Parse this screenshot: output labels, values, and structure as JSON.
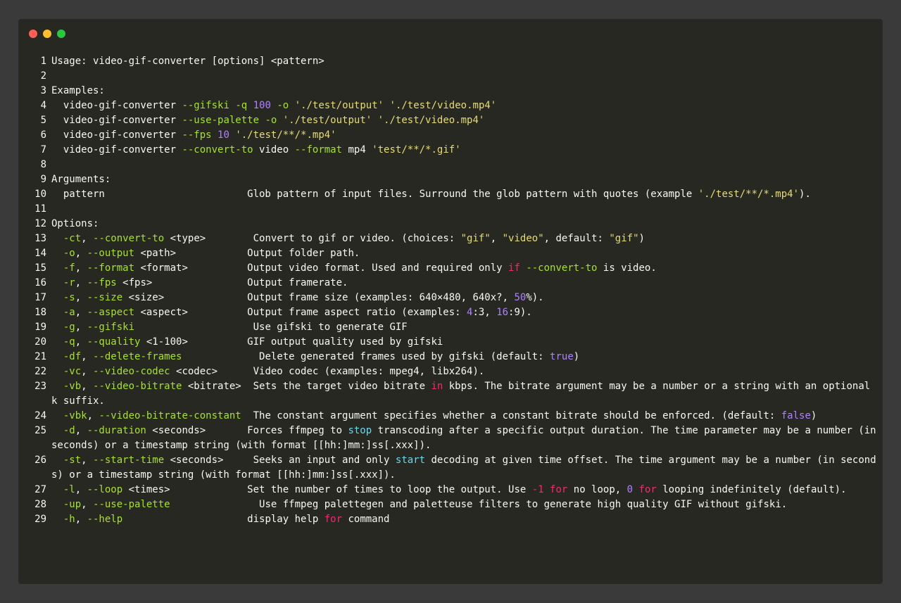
{
  "window": {
    "controls": [
      {
        "name": "close-button",
        "color": "#ff5f56"
      },
      {
        "name": "minimize-button",
        "color": "#ffbd2e"
      },
      {
        "name": "maximize-button",
        "color": "#27c93f"
      }
    ]
  },
  "colors": {
    "flag": "#a6e22e",
    "string": "#e6db74",
    "number": "#ae81ff",
    "keyword": "#f92672",
    "function": "#66d9ef",
    "text": "#f8f8f2",
    "background": "#272822"
  },
  "lines": [
    {
      "n": "1",
      "tokens": [
        {
          "t": "Usage: video-gif-converter [options] <pattern>"
        }
      ]
    },
    {
      "n": "2",
      "tokens": []
    },
    {
      "n": "3",
      "tokens": [
        {
          "t": "Examples:"
        }
      ]
    },
    {
      "n": "4",
      "tokens": [
        {
          "t": "  video-gif-converter "
        },
        {
          "t": "--gifski",
          "c": "flag"
        },
        {
          "t": " "
        },
        {
          "t": "-q",
          "c": "flag"
        },
        {
          "t": " "
        },
        {
          "t": "100",
          "c": "num"
        },
        {
          "t": " "
        },
        {
          "t": "-o",
          "c": "flag"
        },
        {
          "t": " "
        },
        {
          "t": "'./test/output'",
          "c": "str"
        },
        {
          "t": " "
        },
        {
          "t": "'./test/video.mp4'",
          "c": "str"
        }
      ]
    },
    {
      "n": "5",
      "tokens": [
        {
          "t": "  video-gif-converter "
        },
        {
          "t": "--use-palette",
          "c": "flag"
        },
        {
          "t": " "
        },
        {
          "t": "-o",
          "c": "flag"
        },
        {
          "t": " "
        },
        {
          "t": "'./test/output'",
          "c": "str"
        },
        {
          "t": " "
        },
        {
          "t": "'./test/video.mp4'",
          "c": "str"
        }
      ]
    },
    {
      "n": "6",
      "tokens": [
        {
          "t": "  video-gif-converter "
        },
        {
          "t": "--fps",
          "c": "flag"
        },
        {
          "t": " "
        },
        {
          "t": "10",
          "c": "num"
        },
        {
          "t": " "
        },
        {
          "t": "'./test/**/*.mp4'",
          "c": "str"
        }
      ]
    },
    {
      "n": "7",
      "tokens": [
        {
          "t": "  video-gif-converter "
        },
        {
          "t": "--convert-to",
          "c": "flag"
        },
        {
          "t": " video "
        },
        {
          "t": "--format",
          "c": "flag"
        },
        {
          "t": " mp4 "
        },
        {
          "t": "'test/**/*.gif'",
          "c": "str"
        }
      ]
    },
    {
      "n": "8",
      "tokens": []
    },
    {
      "n": "9",
      "tokens": [
        {
          "t": "Arguments:"
        }
      ]
    },
    {
      "n": "10",
      "tokens": [
        {
          "t": "  pattern                        Glob pattern of input files. Surround the glob pattern with quotes (example "
        },
        {
          "t": "'./test/**/*.mp4'",
          "c": "str"
        },
        {
          "t": ")."
        }
      ]
    },
    {
      "n": "11",
      "tokens": []
    },
    {
      "n": "12",
      "tokens": [
        {
          "t": "Options:"
        }
      ]
    },
    {
      "n": "13",
      "tokens": [
        {
          "t": "  "
        },
        {
          "t": "-ct",
          "c": "flag"
        },
        {
          "t": ", "
        },
        {
          "t": "--convert-to",
          "c": "flag"
        },
        {
          "t": " <type>        Convert to gif or video. (choices: "
        },
        {
          "t": "\"gif\"",
          "c": "str"
        },
        {
          "t": ", "
        },
        {
          "t": "\"video\"",
          "c": "str"
        },
        {
          "t": ", default: "
        },
        {
          "t": "\"gif\"",
          "c": "str"
        },
        {
          "t": ")"
        }
      ]
    },
    {
      "n": "14",
      "tokens": [
        {
          "t": "  "
        },
        {
          "t": "-o",
          "c": "flag"
        },
        {
          "t": ", "
        },
        {
          "t": "--output",
          "c": "flag"
        },
        {
          "t": " <path>            Output folder path."
        }
      ]
    },
    {
      "n": "15",
      "tokens": [
        {
          "t": "  "
        },
        {
          "t": "-f",
          "c": "flag"
        },
        {
          "t": ", "
        },
        {
          "t": "--format",
          "c": "flag"
        },
        {
          "t": " <format>          Output video format. Used and required only "
        },
        {
          "t": "if",
          "c": "kw"
        },
        {
          "t": " "
        },
        {
          "t": "--convert-to",
          "c": "flag"
        },
        {
          "t": " is video."
        }
      ]
    },
    {
      "n": "16",
      "tokens": [
        {
          "t": "  "
        },
        {
          "t": "-r",
          "c": "flag"
        },
        {
          "t": ", "
        },
        {
          "t": "--fps",
          "c": "flag"
        },
        {
          "t": " <fps>                Output framerate."
        }
      ]
    },
    {
      "n": "17",
      "tokens": [
        {
          "t": "  "
        },
        {
          "t": "-s",
          "c": "flag"
        },
        {
          "t": ", "
        },
        {
          "t": "--size",
          "c": "flag"
        },
        {
          "t": " <size>              Output frame size (examples: 640×480, 640x?, "
        },
        {
          "t": "50",
          "c": "num"
        },
        {
          "t": "%)."
        }
      ]
    },
    {
      "n": "18",
      "tokens": [
        {
          "t": "  "
        },
        {
          "t": "-a",
          "c": "flag"
        },
        {
          "t": ", "
        },
        {
          "t": "--aspect",
          "c": "flag"
        },
        {
          "t": " <aspect>          Output frame aspect ratio (examples: "
        },
        {
          "t": "4",
          "c": "num"
        },
        {
          "t": ":3, "
        },
        {
          "t": "16",
          "c": "num"
        },
        {
          "t": ":9)."
        }
      ]
    },
    {
      "n": "19",
      "tokens": [
        {
          "t": "  "
        },
        {
          "t": "-g",
          "c": "flag"
        },
        {
          "t": ", "
        },
        {
          "t": "--gifski",
          "c": "flag"
        },
        {
          "t": "                    Use gifski to generate GIF"
        }
      ]
    },
    {
      "n": "20",
      "tokens": [
        {
          "t": "  "
        },
        {
          "t": "-q",
          "c": "flag"
        },
        {
          "t": ", "
        },
        {
          "t": "--quality",
          "c": "flag"
        },
        {
          "t": " <1-100>          GIF output quality used by gifski"
        }
      ]
    },
    {
      "n": "21",
      "tokens": [
        {
          "t": "  "
        },
        {
          "t": "-df",
          "c": "flag"
        },
        {
          "t": ", "
        },
        {
          "t": "--delete-frames",
          "c": "flag"
        },
        {
          "t": "             Delete generated frames used by gifski (default: "
        },
        {
          "t": "true",
          "c": "num"
        },
        {
          "t": ")"
        }
      ]
    },
    {
      "n": "22",
      "tokens": [
        {
          "t": "  "
        },
        {
          "t": "-vc",
          "c": "flag"
        },
        {
          "t": ", "
        },
        {
          "t": "--video-codec",
          "c": "flag"
        },
        {
          "t": " <codec>      Video codec (examples: mpeg4, libx264)."
        }
      ]
    },
    {
      "n": "23",
      "tokens": [
        {
          "t": "  "
        },
        {
          "t": "-vb",
          "c": "flag"
        },
        {
          "t": ", "
        },
        {
          "t": "--video-bitrate",
          "c": "flag"
        },
        {
          "t": " <bitrate>  Sets the target video bitrate "
        },
        {
          "t": "in",
          "c": "kw"
        },
        {
          "t": " kbps. The bitrate argument may be a number or a string with an optional k suffix."
        }
      ]
    },
    {
      "n": "24",
      "tokens": [
        {
          "t": "  "
        },
        {
          "t": "-vbk",
          "c": "flag"
        },
        {
          "t": ", "
        },
        {
          "t": "--video-bitrate-constant",
          "c": "flag"
        },
        {
          "t": "  The constant argument specifies whether a constant bitrate should be enforced. (default: "
        },
        {
          "t": "false",
          "c": "num"
        },
        {
          "t": ")"
        }
      ]
    },
    {
      "n": "25",
      "tokens": [
        {
          "t": "  "
        },
        {
          "t": "-d",
          "c": "flag"
        },
        {
          "t": ", "
        },
        {
          "t": "--duration",
          "c": "flag"
        },
        {
          "t": " <seconds>       Forces ffmpeg to "
        },
        {
          "t": "stop",
          "c": "fn"
        },
        {
          "t": " transcoding after a specific output duration. The time parameter may be a number (in seconds) or a timestamp string (with format [[hh:]mm:]ss[.xxx])."
        }
      ]
    },
    {
      "n": "26",
      "tokens": [
        {
          "t": "  "
        },
        {
          "t": "-st",
          "c": "flag"
        },
        {
          "t": ", "
        },
        {
          "t": "--start-time",
          "c": "flag"
        },
        {
          "t": " <seconds>     Seeks an input and only "
        },
        {
          "t": "start",
          "c": "fn"
        },
        {
          "t": " decoding at given time offset. The time argument may be a number (in seconds) or a timestamp string (with format [[hh:]mm:]ss[.xxx])."
        }
      ]
    },
    {
      "n": "27",
      "tokens": [
        {
          "t": "  "
        },
        {
          "t": "-l",
          "c": "flag"
        },
        {
          "t": ", "
        },
        {
          "t": "--loop",
          "c": "flag"
        },
        {
          "t": " <times>             Set the number of times to loop the output. Use "
        },
        {
          "t": "-1",
          "c": "kw"
        },
        {
          "t": " "
        },
        {
          "t": "for",
          "c": "kw"
        },
        {
          "t": " no loop, "
        },
        {
          "t": "0",
          "c": "num"
        },
        {
          "t": " "
        },
        {
          "t": "for",
          "c": "kw"
        },
        {
          "t": " looping indefinitely (default)."
        }
      ]
    },
    {
      "n": "28",
      "tokens": [
        {
          "t": "  "
        },
        {
          "t": "-up",
          "c": "flag"
        },
        {
          "t": ", "
        },
        {
          "t": "--use-palette",
          "c": "flag"
        },
        {
          "t": "               Use ffmpeg palettegen and paletteuse filters to generate high quality GIF without gifski."
        }
      ]
    },
    {
      "n": "29",
      "tokens": [
        {
          "t": "  "
        },
        {
          "t": "-h",
          "c": "flag"
        },
        {
          "t": ", "
        },
        {
          "t": "--help",
          "c": "flag"
        },
        {
          "t": "                     display help "
        },
        {
          "t": "for",
          "c": "kw"
        },
        {
          "t": " command"
        }
      ]
    }
  ]
}
